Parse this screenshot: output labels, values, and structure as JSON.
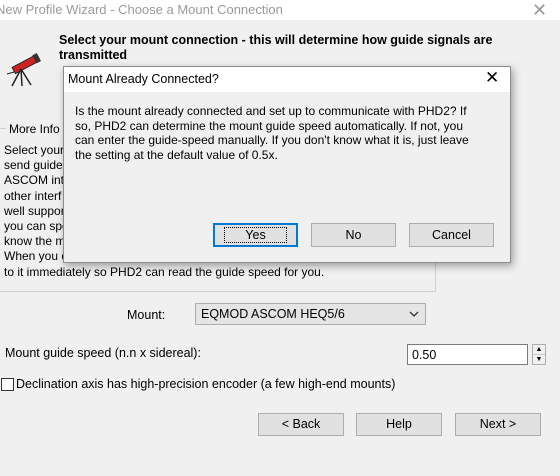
{
  "window": {
    "title": "New Profile Wizard - Choose a Mount Connection",
    "close_symbol": "✕"
  },
  "wizard": {
    "heading": "Select your mount connection - this will determine how guide signals are transmitted",
    "group_label": "More Info",
    "info_lines": [
      "Select your",
      "send guide",
      "ASCOM inte",
      "other interf",
      "well suppor",
      "you can spe",
      "know the m",
      "When you c",
      "to it immediately so PHD2 can read the guide speed for you."
    ],
    "mount_label": "Mount:",
    "mount_value": "EQMOD ASCOM HEQ5/6",
    "speed_label": "Mount guide speed (n.n x sidereal):",
    "speed_value": "0.50",
    "declination_label": "Declination axis has high-precision encoder (a few high-end mounts)",
    "back_label": "< Back",
    "help_label": "Help",
    "next_label": "Next >"
  },
  "dialog": {
    "title": "Mount Already Connected?",
    "close_symbol": "✕",
    "message_lines": [
      "Is the mount already connected and set up to communicate with PHD2?  If",
      "so, PHD2 can determine the mount guide speed automatically.  If not, you",
      "can enter the guide-speed manually.  If you don't know what it is, just leave",
      "the setting at the default value of 0.5x."
    ],
    "yes_label": "Yes",
    "no_label": "No",
    "cancel_label": "Cancel"
  },
  "icons": {
    "app": "telescope-icon",
    "dropdown": "chevron-down-icon",
    "spin_up": "spin-up-icon",
    "spin_down": "spin-down-icon"
  },
  "colors": {
    "focus_accent": "#0078d7",
    "window_bg": "#f0f0f0",
    "telescope_red": "#cc2222"
  }
}
